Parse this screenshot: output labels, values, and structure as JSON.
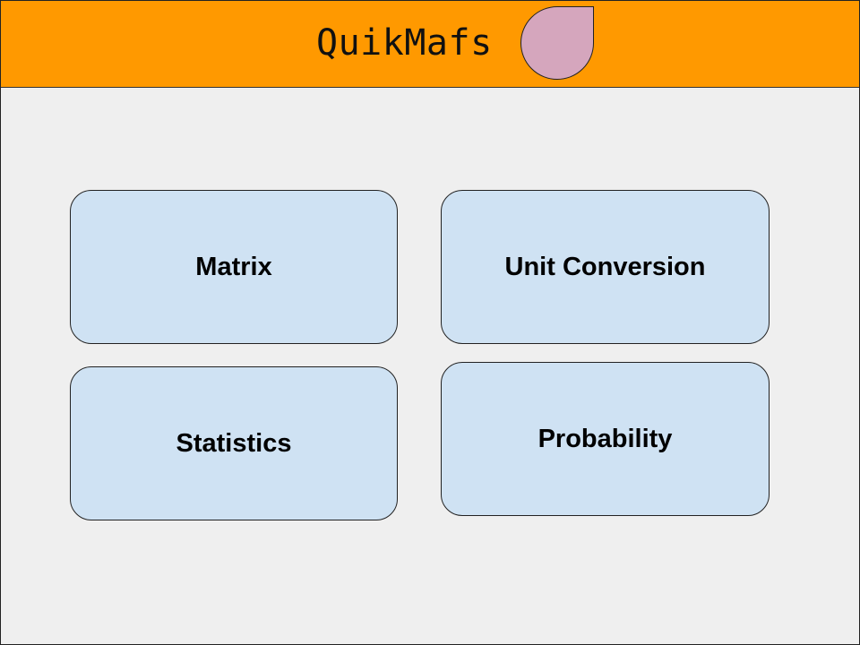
{
  "header": {
    "title": "QuikMafs",
    "background_color": "#ff9900",
    "logo_color": "#d5a6bd",
    "logo_icon": "teardrop-logo-icon"
  },
  "tiles": [
    {
      "label": "Matrix"
    },
    {
      "label": "Unit Conversion"
    },
    {
      "label": "Statistics"
    },
    {
      "label": "Probability"
    }
  ],
  "colors": {
    "page_background": "#efefef",
    "tile_fill": "#cfe2f3",
    "outline": "#222222"
  }
}
